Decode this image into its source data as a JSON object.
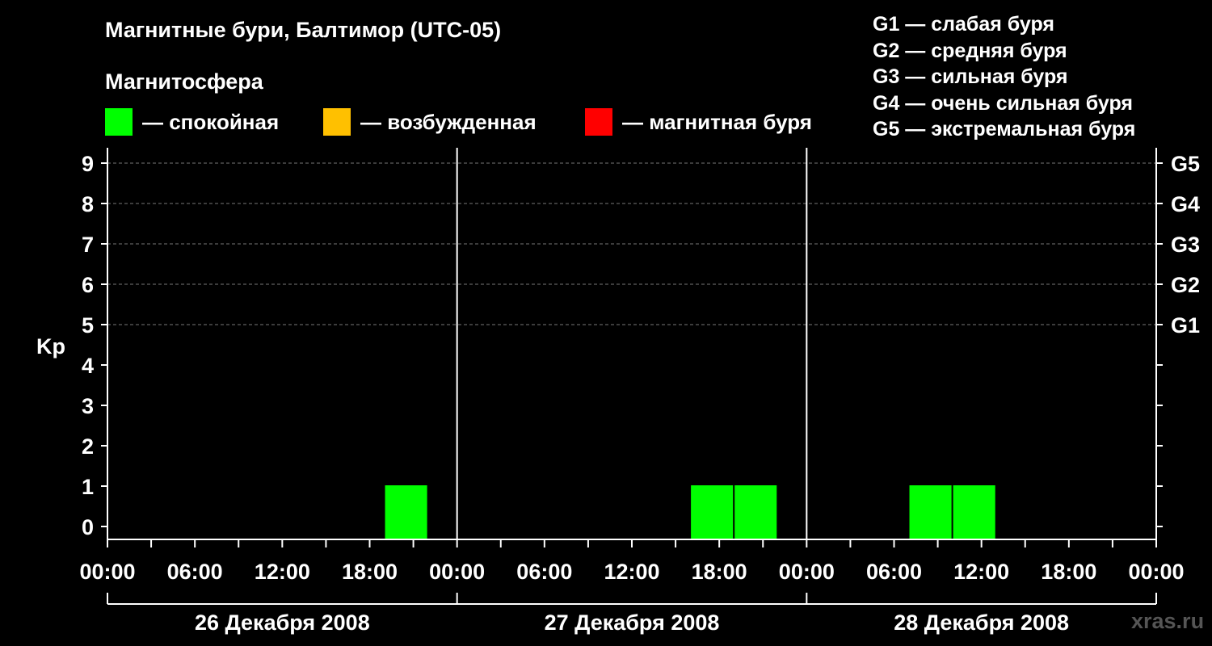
{
  "header": {
    "title": "Магнитные бури, Балтимор (UTC-05)",
    "subtitle": "Магнитосфера"
  },
  "legend": [
    {
      "label": "— спокойная",
      "color": "#00ff00"
    },
    {
      "label": "— возбужденная",
      "color": "#ffc000"
    },
    {
      "label": "— магнитная буря",
      "color": "#ff0000"
    }
  ],
  "g_legend": [
    "G1 — слабая буря",
    "G2 — средняя буря",
    "G3 — сильная буря",
    "G4 — очень сильная буря",
    "G5 — экстремальная буря"
  ],
  "watermark": "xras.ru",
  "chart_data": {
    "type": "bar",
    "title": "Магнитные бури, Балтимор (UTC-05)",
    "ylabel": "Kp",
    "ylim": [
      0,
      9
    ],
    "y_ticks": [
      "0",
      "1",
      "2",
      "3",
      "4",
      "5",
      "6",
      "7",
      "8",
      "9"
    ],
    "right_axis": [
      {
        "kp": 5,
        "label": "G1"
      },
      {
        "kp": 6,
        "label": "G2"
      },
      {
        "kp": 7,
        "label": "G3"
      },
      {
        "kp": 8,
        "label": "G4"
      },
      {
        "kp": 9,
        "label": "G5"
      }
    ],
    "x_ticks": [
      "00:00",
      "06:00",
      "12:00",
      "18:00",
      "00:00",
      "06:00",
      "12:00",
      "18:00",
      "00:00",
      "06:00",
      "12:00",
      "18:00",
      "00:00"
    ],
    "days": [
      "26 Декабря 2008",
      "27 Декабря 2008",
      "28 Декабря 2008"
    ],
    "bars": [
      {
        "day": 0,
        "start_hour": 19,
        "end_hour": 22,
        "kp": 1,
        "status": "calm"
      },
      {
        "day": 1,
        "start_hour": 16,
        "end_hour": 19,
        "kp": 1,
        "status": "calm"
      },
      {
        "day": 1,
        "start_hour": 19,
        "end_hour": 22,
        "kp": 1,
        "status": "calm"
      },
      {
        "day": 2,
        "start_hour": 7,
        "end_hour": 10,
        "kp": 1,
        "status": "calm"
      },
      {
        "day": 2,
        "start_hour": 10,
        "end_hour": 13,
        "kp": 1,
        "status": "calm"
      }
    ],
    "colors": {
      "calm": "#00ff00",
      "excited": "#ffc000",
      "storm": "#ff0000"
    },
    "grid": true
  }
}
